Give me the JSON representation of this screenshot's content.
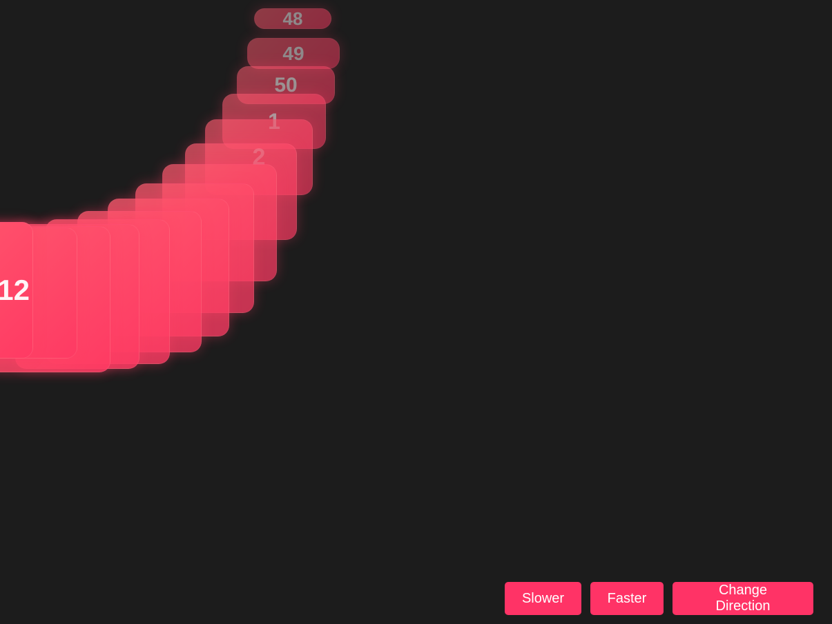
{
  "carousel": {
    "cards": [
      {
        "label": "48",
        "opacity": 0.5
      },
      {
        "label": "49",
        "opacity": 0.5
      },
      {
        "label": "50",
        "opacity": 0.55
      },
      {
        "label": "1",
        "opacity": 0.6
      },
      {
        "label": "2",
        "opacity": 0.65
      },
      {
        "label": "",
        "opacity": 0.7
      },
      {
        "label": "",
        "opacity": 0.72
      },
      {
        "label": "",
        "opacity": 0.75
      },
      {
        "label": "",
        "opacity": 0.78
      },
      {
        "label": "",
        "opacity": 0.8
      },
      {
        "label": "",
        "opacity": 0.82
      },
      {
        "label": "",
        "opacity": 0.85
      },
      {
        "label": "",
        "opacity": 0.88
      },
      {
        "label": "",
        "opacity": 0.9
      },
      {
        "label": "12",
        "opacity": 1.0
      }
    ],
    "colors": {
      "background": "#1c1c1c",
      "card": "#ff4d6d",
      "button": "#ff3366"
    }
  },
  "controls": {
    "slower_label": "Slower",
    "faster_label": "Faster",
    "direction_label": "Change Direction"
  }
}
